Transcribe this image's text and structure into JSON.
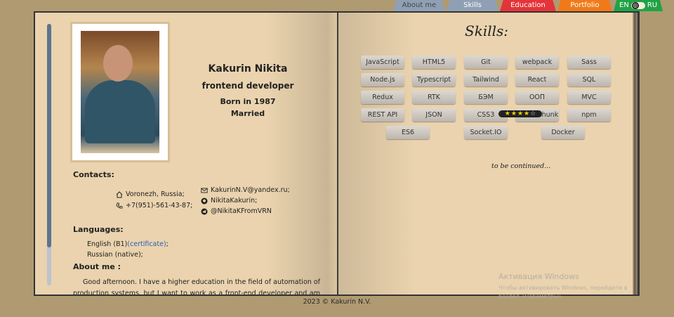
{
  "nav": {
    "tabs": [
      {
        "label": "About me"
      },
      {
        "label": "Skills"
      },
      {
        "label": "Education"
      },
      {
        "label": "Portfolio"
      }
    ],
    "lang_en": "EN",
    "lang_ru": "RU"
  },
  "profile": {
    "name": "Kakurin Nikita",
    "role": "frontend developer",
    "born": "Born in 1987",
    "status": "Married"
  },
  "contacts": {
    "heading": "Contacts:",
    "location": "Voronezh, Russia;",
    "phone": "+7(951)-561-43-87;",
    "email": "KakurinN.V@yandex.ru;",
    "github": "NikitaKakurin;",
    "telegram": "@NikitaKFromVRN"
  },
  "languages": {
    "heading": "Languages:",
    "english": "English (B1)",
    "certificate": "(certificate)",
    "english_suffix": ";",
    "russian": "Russian (native);"
  },
  "about": {
    "heading": "About me :",
    "text": "Good afternoon. I have a higher education in the field of automation of production systems, but I want to work as a front-end developer and am open"
  },
  "skills": {
    "title": "Skills:",
    "items": [
      "JavaScript",
      "HTML5",
      "Git",
      "webpack",
      "Sass",
      "Node.js",
      "Typescript",
      "Tailwind",
      "React",
      "SQL",
      "Redux",
      "RTK",
      "БЭМ",
      "ООП",
      "MVC",
      "REST API",
      "JSON",
      "CSS3",
      "Redux-thunk",
      "npm",
      "ES6",
      "Socket.IO",
      "Docker"
    ],
    "hovered_rating": {
      "skill": "БЭМ",
      "stars": 4,
      "max": 5
    },
    "continued": "to be continued..."
  },
  "watermark": {
    "line1": "Активация Windows",
    "line2": "Чтобы активировать Windows, перейдите в раздел «Параметры»."
  },
  "footer": "2023 © Kakurin N.V.",
  "colors": {
    "page_bg": "#b09a72",
    "book": "#ead3ae",
    "tab_education": "#e5333a",
    "tab_portfolio": "#f07a1a",
    "tab_lang": "#21a247",
    "link": "#2a5db0"
  }
}
